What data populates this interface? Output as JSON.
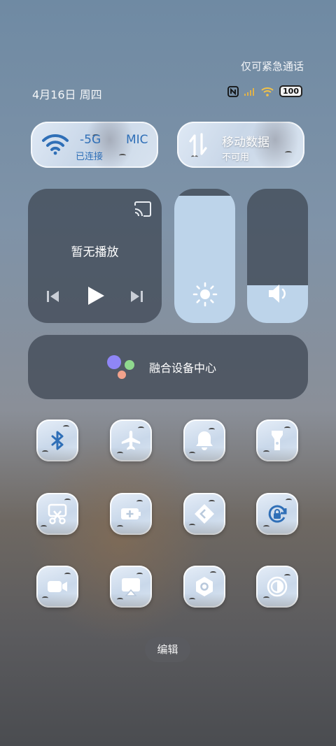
{
  "status": {
    "emergency_only": "仅可紧急通话",
    "date": "4月16日 周四",
    "battery": "100"
  },
  "wifi": {
    "network": "-5G",
    "ssid_fragment": "MIC",
    "state": "已连接"
  },
  "mobile_data": {
    "title": "移动数据",
    "state": "不可用"
  },
  "media": {
    "title": "暂无播放"
  },
  "sliders": {
    "brightness_level": 0.95,
    "volume_level": 0.28
  },
  "fusion": {
    "label": "融合设备中心",
    "dot_colors": [
      "#8f86f6",
      "#8fd88e",
      "#f2a28c"
    ]
  },
  "toggles": [
    {
      "icon": "bluetooth-icon"
    },
    {
      "icon": "airplane-icon"
    },
    {
      "icon": "bell-icon"
    },
    {
      "icon": "flashlight-icon"
    },
    {
      "icon": "screenshot-icon"
    },
    {
      "icon": "battery-saver-icon"
    },
    {
      "icon": "nearby-share-icon"
    },
    {
      "icon": "rotation-lock-icon"
    },
    {
      "icon": "screen-record-icon"
    },
    {
      "icon": "screen-cast-icon"
    },
    {
      "icon": "settings-hex-icon"
    },
    {
      "icon": "dark-mode-icon"
    }
  ],
  "edit_label": "编辑",
  "colors": {
    "icon_blue": "#2f6fb7",
    "icon_white": "#ffffff",
    "slider_fill": "#bdd4ea"
  }
}
